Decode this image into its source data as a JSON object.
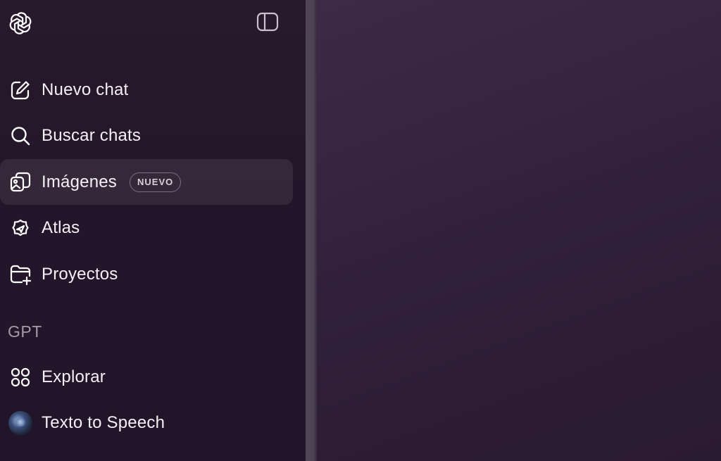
{
  "sidebar": {
    "logo_icon": "openai-logo-icon",
    "toggle_icon": "sidebar-toggle-icon",
    "items": [
      {
        "label": "Nuevo chat",
        "icon": "edit-icon"
      },
      {
        "label": "Buscar chats",
        "icon": "search-icon"
      },
      {
        "label": "Imágenes",
        "icon": "images-icon",
        "badge": "NUEVO",
        "active": true
      },
      {
        "label": "Atlas",
        "icon": "compass-icon"
      },
      {
        "label": "Proyectos",
        "icon": "folder-add-icon"
      }
    ],
    "gpt_section": {
      "title": "GPT",
      "items": [
        {
          "label": "Explorar",
          "icon": "grid-icon"
        },
        {
          "label": "Texto to Speech",
          "icon": "avatar"
        }
      ]
    }
  },
  "colors": {
    "sidebar_bg": "#251729",
    "main_bg": "#35233f",
    "text": "#f4f0f5",
    "section_title": "#a59aa9"
  }
}
